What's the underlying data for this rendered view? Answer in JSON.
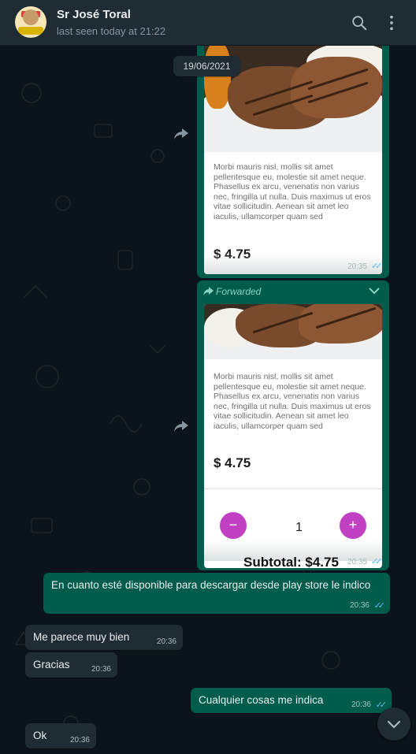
{
  "header": {
    "contact_name": "Sr José Toral",
    "last_seen": "last seen today at 21:22",
    "icons": [
      "search-icon",
      "menu-dots-icon"
    ]
  },
  "chat": {
    "date_chip": "19/06/2021",
    "card1": {
      "description": "Morbi mauris nisl, mollis sit amet pellentesque eu, molestie sit amet neque. Phasellus ex arcu, venenatis non varius nec, fringilla ut nulla. Duis maximus ut eros vitae sollicitudin. Aenean sit amet leo iaculis, ullamcorper quam sed",
      "price": "$ 4.75",
      "time": "20:35"
    },
    "card2": {
      "forwarded_label": "Forwarded",
      "description": "Morbi mauris nisl, mollis sit amet pellentesque eu, molestie sit amet neque. Phasellus ex arcu, venenatis non varius nec, fringilla ut nulla. Duis maximus ut eros vitae sollicitudin. Aenean sit amet leo iaculis, ullamcorper quam sed",
      "price": "$ 4.75",
      "minus_label": "−",
      "plus_label": "+",
      "quantity": "1",
      "subtotal": "Subtotal: $4.75",
      "time": "20:35"
    },
    "messages": [
      {
        "dir": "out",
        "text": "En cuanto esté disponible para descargar desde play store le indico",
        "time": "20:36"
      },
      {
        "dir": "in",
        "text": "Me parece muy bien",
        "time": "20:36"
      },
      {
        "dir": "in",
        "text": "Gracias",
        "time": "20:36"
      },
      {
        "dir": "out",
        "text": "Cualquier cosas me indica",
        "time": "20:36"
      },
      {
        "dir": "in",
        "text": "Ok",
        "time": "20:36"
      }
    ],
    "colors": {
      "outgoing": "#005c4b",
      "incoming": "#202c33",
      "read_ticks": "#53bdeb",
      "qty_buttons": "#c03fc2"
    }
  }
}
